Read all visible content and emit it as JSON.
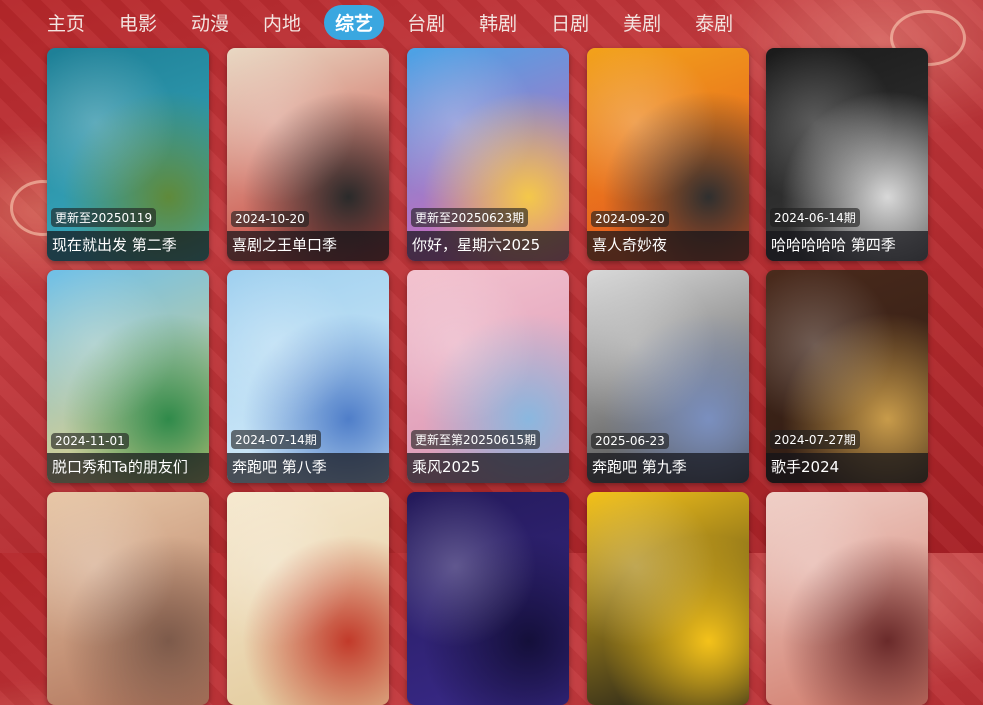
{
  "tabs": [
    "主页",
    "电影",
    "动漫",
    "内地",
    "综艺",
    "台剧",
    "韩剧",
    "日剧",
    "美剧",
    "泰剧"
  ],
  "active_tab": "综艺",
  "cards": [
    {
      "date": "更新至20250119",
      "title": "现在就出发 第二季",
      "poster_colors": [
        "#1d7f96",
        "#3fb0c4",
        "#5f8a3a"
      ]
    },
    {
      "date": "2024-10-20",
      "title": "喜剧之王单口季",
      "poster_colors": [
        "#e9d9c4",
        "#c4332e",
        "#2a2a2a"
      ]
    },
    {
      "date": "更新至20250623期",
      "title": "你好，星期六2025",
      "poster_colors": [
        "#4aa3e6",
        "#e85ab0",
        "#f4c84a"
      ]
    },
    {
      "date": "2024-09-20",
      "title": "喜人奇妙夜",
      "poster_colors": [
        "#f2a21b",
        "#e24a1f",
        "#2f2f2f"
      ]
    },
    {
      "date": "2024-06-14期",
      "title": "哈哈哈哈哈 第四季",
      "poster_colors": [
        "#1a1a1a",
        "#3d3d3d",
        "#d8d8d8"
      ]
    },
    {
      "date": "2024-11-01",
      "title": "脱口秀和Ta的朋友们",
      "poster_colors": [
        "#6fc0e8",
        "#f1d27a",
        "#2f8a4a"
      ]
    },
    {
      "date": "2024-07-14期",
      "title": "奔跑吧 第八季",
      "poster_colors": [
        "#9fd0ef",
        "#dbeefa",
        "#4f7ec9"
      ]
    },
    {
      "date": "更新至第20250615期",
      "title": "乘风2025",
      "poster_colors": [
        "#f3c3cf",
        "#d88fb0",
        "#8ab7df"
      ]
    },
    {
      "date": "2025-06-23",
      "title": "奔跑吧 第九季",
      "poster_colors": [
        "#d9d9d9",
        "#3b3b3b",
        "#7a8fbf"
      ]
    },
    {
      "date": "2024-07-27期",
      "title": "歌手2024",
      "poster_colors": [
        "#4a2a1c",
        "#2b1a12",
        "#c89b4a"
      ]
    },
    {
      "date": "",
      "title": "",
      "poster_colors": [
        "#e8c8a8",
        "#b0735a",
        "#7d5a4a"
      ]
    },
    {
      "date": "",
      "title": "",
      "poster_colors": [
        "#f6e9d0",
        "#e2c99a",
        "#c23a2a"
      ]
    },
    {
      "date": "",
      "title": "",
      "poster_colors": [
        "#241a5a",
        "#3a2a8a",
        "#140f3a"
      ]
    },
    {
      "date": "",
      "title": "",
      "poster_colors": [
        "#f4c21a",
        "#1a1a1a",
        "#f4c21a"
      ]
    },
    {
      "date": "",
      "title": "",
      "poster_colors": [
        "#f0d0c8",
        "#d07a6a",
        "#6a2a2a"
      ]
    }
  ],
  "colors": {
    "accent": "#3aa7e0",
    "background": "#b5262a"
  }
}
